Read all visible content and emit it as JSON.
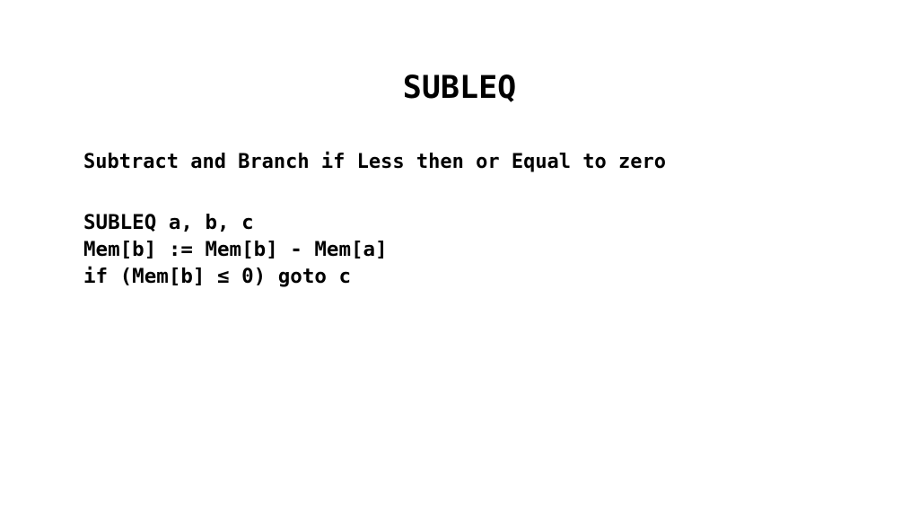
{
  "slide": {
    "title": "SUBLEQ",
    "subtitle": "Subtract and Branch if Less then or Equal to zero",
    "code_lines": [
      "SUBLEQ a, b, c",
      "Mem[b] := Mem[b] - Mem[a]",
      "if (Mem[b] ≤ 0) goto c"
    ]
  },
  "colors": {
    "background": "#ffffff",
    "text": "#000000"
  }
}
